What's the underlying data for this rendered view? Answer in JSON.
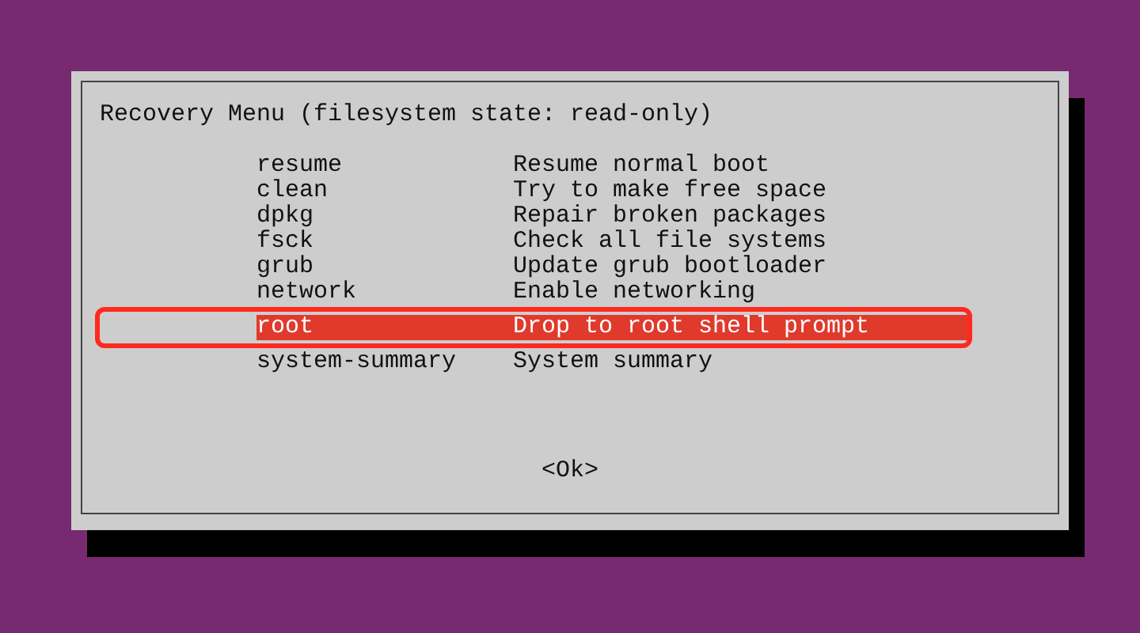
{
  "dialog": {
    "title": "Recovery Menu (filesystem state: read-only)",
    "items": [
      {
        "command": "resume",
        "description": "Resume normal boot",
        "selected": false,
        "annotated": false
      },
      {
        "command": "clean",
        "description": "Try to make free space",
        "selected": false,
        "annotated": false
      },
      {
        "command": "dpkg",
        "description": "Repair broken packages",
        "selected": false,
        "annotated": false
      },
      {
        "command": "fsck",
        "description": "Check all file systems",
        "selected": false,
        "annotated": false
      },
      {
        "command": "grub",
        "description": "Update grub bootloader",
        "selected": false,
        "annotated": false
      },
      {
        "command": "network",
        "description": "Enable networking",
        "selected": false,
        "annotated": false
      },
      {
        "command": "root",
        "description": "Drop to root shell prompt",
        "selected": true,
        "annotated": true
      },
      {
        "command": "system-summary",
        "description": "System summary",
        "selected": false,
        "annotated": false
      }
    ],
    "button": "<Ok>"
  }
}
